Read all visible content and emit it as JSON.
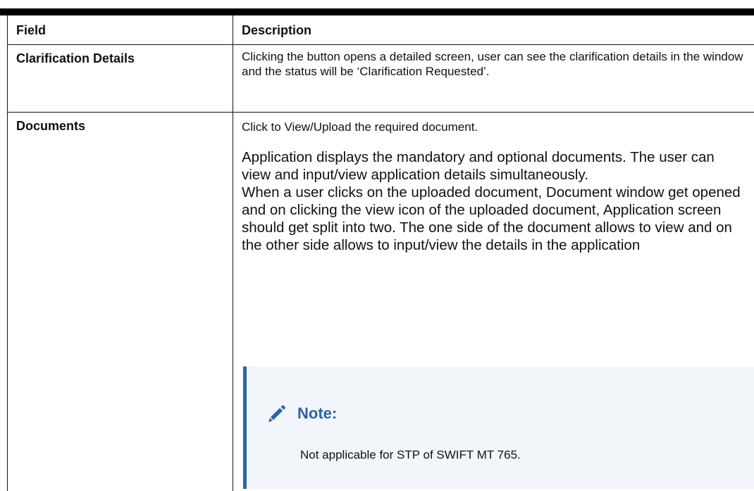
{
  "table": {
    "headers": {
      "field": "Field",
      "description": "Description"
    },
    "rows": [
      {
        "field": "Clarification Details",
        "description": "Clicking the button opens a detailed screen, user can see the clarification details in the window and the status will be ‘Clarification Requested’."
      },
      {
        "field": "Documents",
        "description_intro": "Click to View/Upload the required document.",
        "description_body_1": "Application displays the mandatory and optional documents. The user can view and input/view application details simultaneously.",
        "description_body_2": "When a user clicks on the uploaded document, Document window get opened and on clicking the view icon of the uploaded document, Application screen should get split into two. The one side of the document allows to view and on the other side allows to input/view the details in the application"
      }
    ]
  },
  "note": {
    "icon": "pencil-icon",
    "title": "Note:",
    "text": "Not applicable for STP of SWIFT MT 765.",
    "accent_color": "#2a66a6",
    "background_color": "#f2f6fb"
  }
}
